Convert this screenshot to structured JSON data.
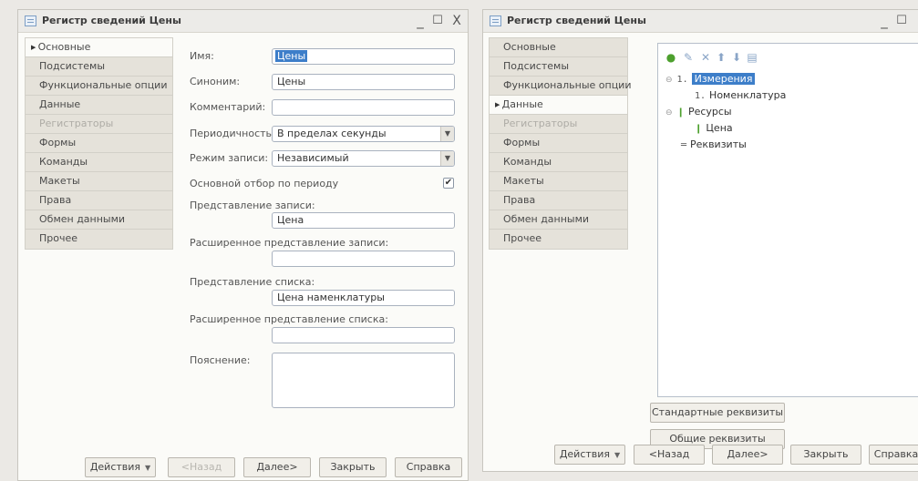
{
  "window_left": {
    "title": "Регистр сведений Цены",
    "controls": {
      "minimize": "_",
      "maximize": "☐",
      "close": "X"
    },
    "sidebar": [
      {
        "label": "Основные",
        "active": true,
        "disabled": false
      },
      {
        "label": "Подсистемы",
        "active": false,
        "disabled": false
      },
      {
        "label": "Функциональные опции",
        "active": false,
        "disabled": false
      },
      {
        "label": "Данные",
        "active": false,
        "disabled": false
      },
      {
        "label": "Регистраторы",
        "active": false,
        "disabled": true
      },
      {
        "label": "Формы",
        "active": false,
        "disabled": false
      },
      {
        "label": "Команды",
        "active": false,
        "disabled": false
      },
      {
        "label": "Макеты",
        "active": false,
        "disabled": false
      },
      {
        "label": "Права",
        "active": false,
        "disabled": false
      },
      {
        "label": "Обмен данными",
        "active": false,
        "disabled": false
      },
      {
        "label": "Прочее",
        "active": false,
        "disabled": false
      }
    ],
    "form": {
      "name_label": "Имя:",
      "name_value": "Цены",
      "synonym_label": "Синоним:",
      "synonym_value": "Цены",
      "comment_label": "Комментарий:",
      "comment_value": "",
      "periodicity_label": "Периодичность:",
      "periodicity_value": "В пределах секунды",
      "write_mode_label": "Режим записи:",
      "write_mode_value": "Независимый",
      "main_filter_label": "Основной отбор по периоду",
      "main_filter_checked": true,
      "record_repr_label": "Представление записи:",
      "record_repr_value": "Цена",
      "ext_record_repr_label": "Расширенное представление записи:",
      "ext_record_repr_value": "",
      "list_repr_label": "Представление списка:",
      "list_repr_value": "Цена наменклатуры",
      "ext_list_repr_label": "Расширенное представление списка:",
      "ext_list_repr_value": "",
      "explanation_label": "Пояснение:"
    },
    "buttons": {
      "actions": "Действия",
      "back": "<Назад",
      "next": "Далее>",
      "close": "Закрыть",
      "help": "Справка"
    }
  },
  "window_right": {
    "title": "Регистр сведений Цены",
    "controls": {
      "minimize": "_",
      "maximize": "☐"
    },
    "sidebar": [
      {
        "label": "Основные",
        "active": false,
        "disabled": false
      },
      {
        "label": "Подсистемы",
        "active": false,
        "disabled": false
      },
      {
        "label": "Функциональные опции",
        "active": false,
        "disabled": false
      },
      {
        "label": "Данные",
        "active": true,
        "disabled": false
      },
      {
        "label": "Регистраторы",
        "active": false,
        "disabled": true
      },
      {
        "label": "Формы",
        "active": false,
        "disabled": false
      },
      {
        "label": "Команды",
        "active": false,
        "disabled": false
      },
      {
        "label": "Макеты",
        "active": false,
        "disabled": false
      },
      {
        "label": "Права",
        "active": false,
        "disabled": false
      },
      {
        "label": "Обмен данными",
        "active": false,
        "disabled": false
      },
      {
        "label": "Прочее",
        "active": false,
        "disabled": false
      }
    ],
    "toolbar_icons": [
      "add-icon",
      "edit-icon",
      "delete-icon",
      "move-up-icon",
      "move-down-icon",
      "sort-icon"
    ],
    "tree": {
      "dimensions": "Измерения",
      "dimension_item": "Номенклатура",
      "resources": "Ресурсы",
      "resource_item": "Цена",
      "attributes": "Реквизиты"
    },
    "standard_attributes_button": "Стандартные реквизиты",
    "common_attributes_button": "Общие реквизиты",
    "buttons": {
      "actions": "Действия",
      "back": "<Назад",
      "next": "Далее>",
      "close": "Закрыть",
      "help": "Справка"
    }
  }
}
